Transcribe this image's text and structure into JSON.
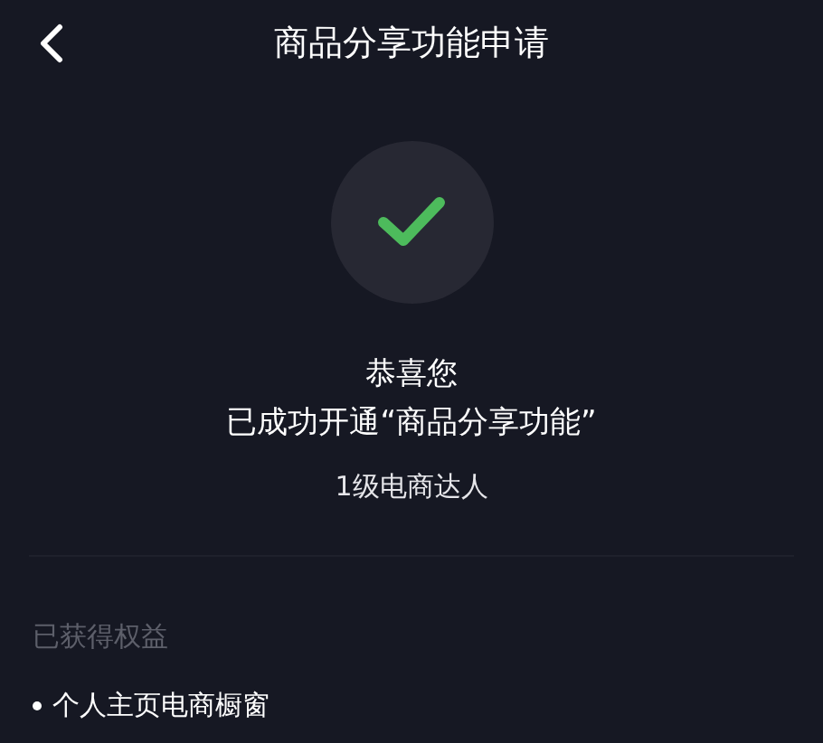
{
  "header": {
    "title": "商品分享功能申请"
  },
  "result": {
    "heading": "恭喜您",
    "message": "已成功开通“商品分享功能”",
    "level": "1级电商达人"
  },
  "benefits": {
    "title": "已获得权益",
    "items": [
      "个人主页电商橱窗"
    ]
  }
}
